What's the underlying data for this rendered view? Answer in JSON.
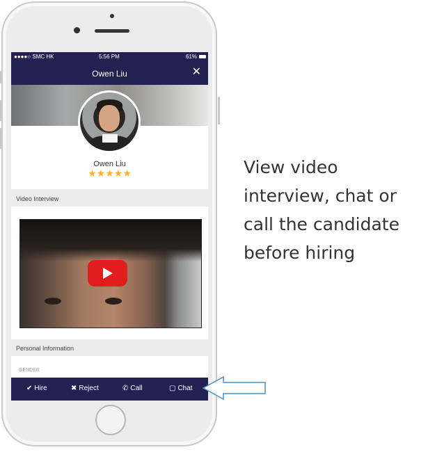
{
  "status_bar": {
    "carrier": "●●●●○ SMC HK",
    "time": "5:56 PM",
    "battery": "61%"
  },
  "header": {
    "title": "Owen Liu",
    "close_icon": "close-icon"
  },
  "profile": {
    "name": "Owen Liu",
    "stars": "★★★★★",
    "rating": 5
  },
  "sections": {
    "video_interview": "Video Interview",
    "personal_information": "Personal Information"
  },
  "personal": {
    "gender_label": "GENDER"
  },
  "actions": [
    {
      "label": "Hire",
      "icon": "check-circle-icon"
    },
    {
      "label": "Reject",
      "icon": "x-circle-icon"
    },
    {
      "label": "Call",
      "icon": "phone-icon"
    },
    {
      "label": "Chat",
      "icon": "chat-icon"
    }
  ],
  "caption": "View video interview, chat or call the candidate before hiring",
  "colors": {
    "nav_bar": "#232052",
    "star": "#f2b32d",
    "play_button": "#e21d1d",
    "arrow_outline": "#4f8fc6"
  }
}
